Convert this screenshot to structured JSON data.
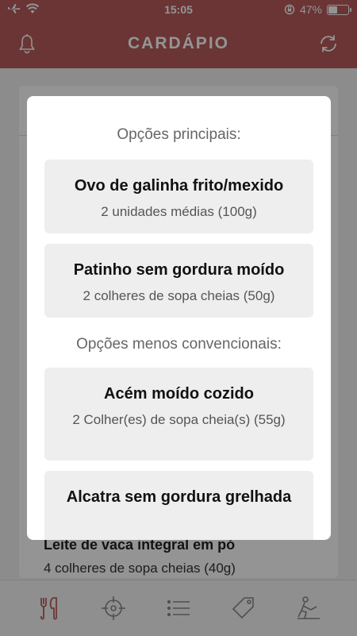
{
  "status": {
    "time": "15:05",
    "battery": "47%",
    "battery_level": 0.47
  },
  "header": {
    "title": "CARDÁPIO"
  },
  "background": {
    "food_title": "Leite de vaca integral em pó",
    "food_subtitle": "4 colheres de sopa cheias (40g)"
  },
  "modal": {
    "sections": [
      {
        "label": "Opções principais:",
        "options": [
          {
            "title": "Ovo de galinha frito/mexido",
            "subtitle": "2 unidades médias (100g)"
          },
          {
            "title": "Patinho sem gordura moído",
            "subtitle": "2 colheres de sopa cheias (50g)"
          }
        ]
      },
      {
        "label": "Opções menos convencionais:",
        "options": [
          {
            "title": "Acém moído cozido",
            "subtitle": "2 Colher(es) de sopa cheia(s) (55g)"
          },
          {
            "title": "Alcatra sem gordura grelhada",
            "subtitle": ""
          }
        ]
      }
    ]
  },
  "tabs": [
    {
      "icon": "utensils-icon",
      "active": true
    },
    {
      "icon": "target-icon",
      "active": false
    },
    {
      "icon": "list-icon",
      "active": false
    },
    {
      "icon": "tag-icon",
      "active": false
    },
    {
      "icon": "exercise-icon",
      "active": false
    }
  ],
  "colors": {
    "brand": "#b95c5c",
    "active_tab": "#b95c5c",
    "inactive_tab": "#888888"
  }
}
